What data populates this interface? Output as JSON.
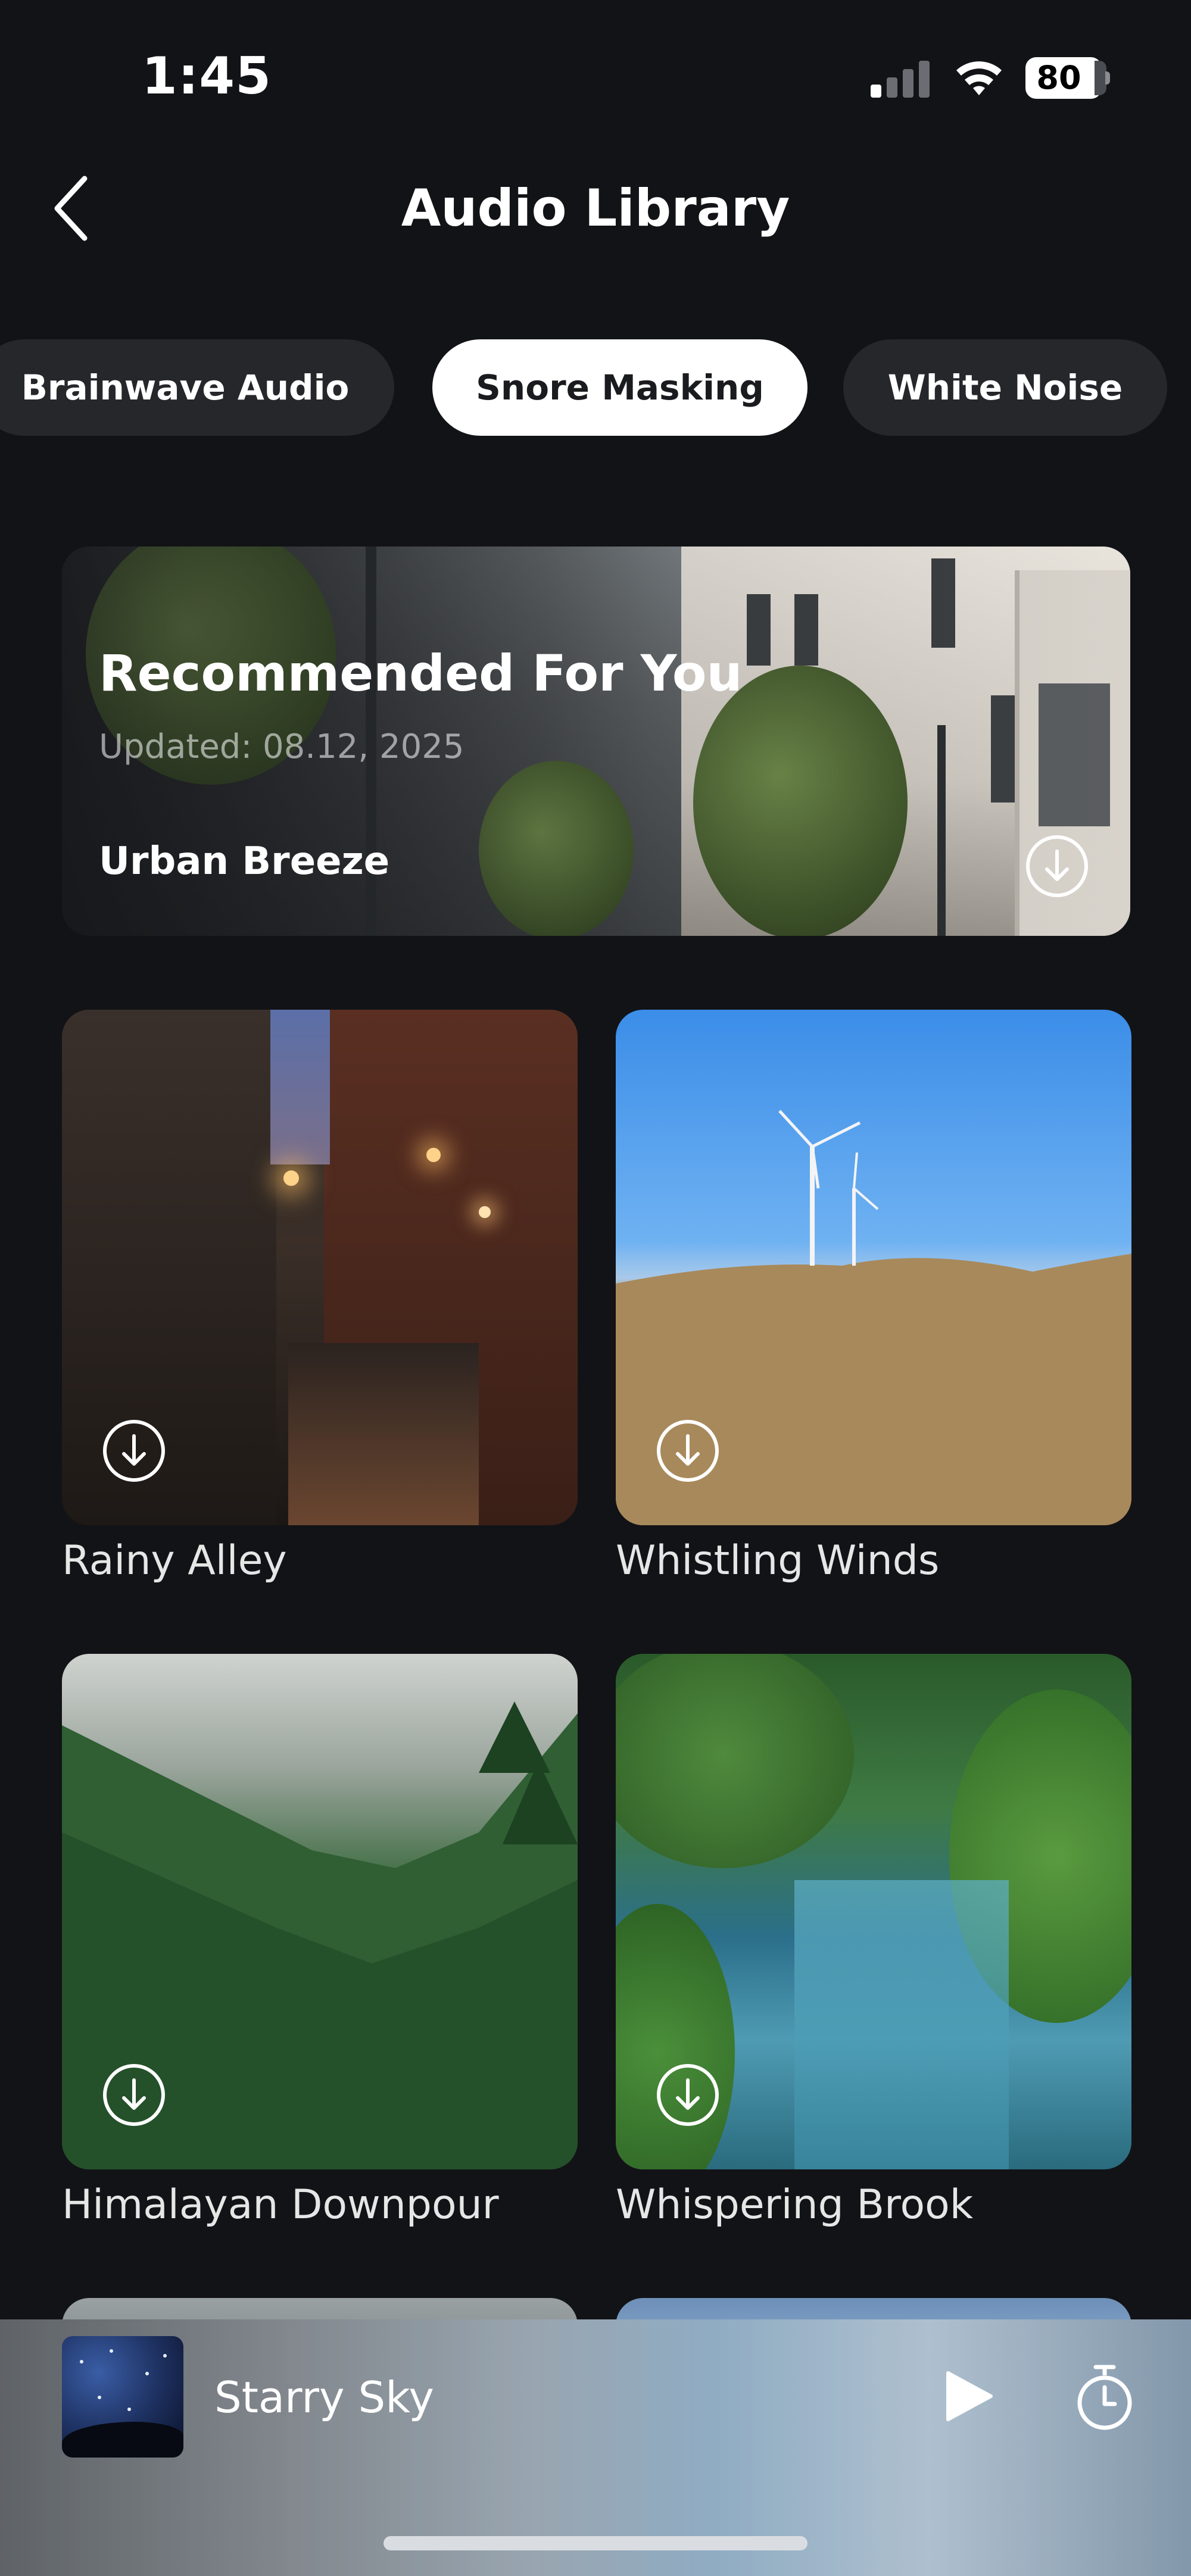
{
  "status_bar": {
    "time": "1:45",
    "battery": "80"
  },
  "header": {
    "back_icon": "chevron-left-icon",
    "title": "Audio Library"
  },
  "tabs": [
    {
      "label": "Brainwave Audio",
      "active": false
    },
    {
      "label": "Snore Masking",
      "active": true
    },
    {
      "label": "White Noise",
      "active": false
    }
  ],
  "featured": {
    "title": "Recommended For You",
    "updated": "Updated: 08.12, 2025",
    "track": "Urban Breeze",
    "download_icon": "download-icon"
  },
  "tracks": [
    {
      "name": "Rainy Alley",
      "download_icon": "download-icon"
    },
    {
      "name": "Whistling Winds",
      "download_icon": "download-icon"
    },
    {
      "name": "Himalayan Downpour",
      "download_icon": "download-icon"
    },
    {
      "name": "Whispering Brook",
      "download_icon": "download-icon"
    }
  ],
  "player": {
    "now_playing": "Starry Sky",
    "play_icon": "play-icon",
    "timer_icon": "timer-icon"
  },
  "colors": {
    "background": "#121316",
    "tab_inactive": "#25272b",
    "tab_active": "#ffffff"
  }
}
